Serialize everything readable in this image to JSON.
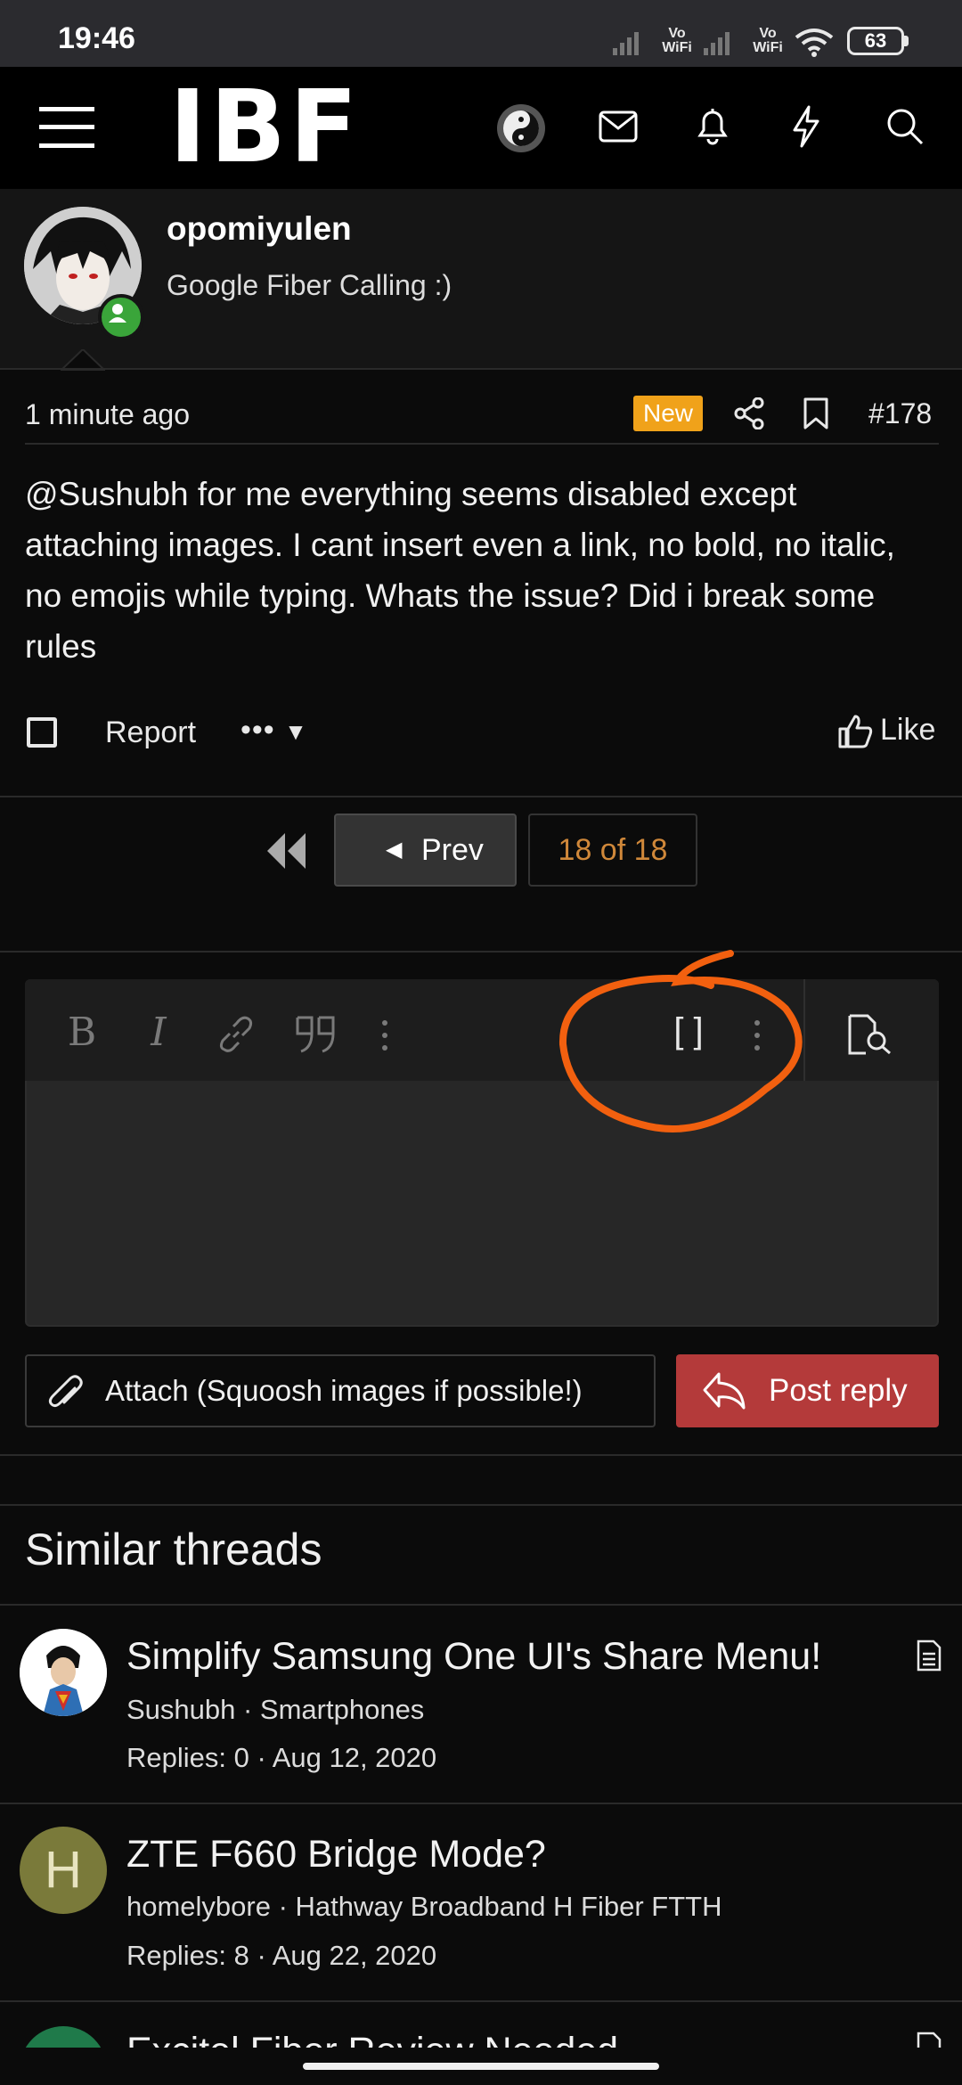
{
  "status_bar": {
    "time": "19:46",
    "vowifi_1": "Vo\nWiFi",
    "vowifi_2": "Vo\nWiFi",
    "battery": "63"
  },
  "header": {
    "logo": "IBF",
    "icons": [
      "menu-icon",
      "yin-yang-icon",
      "mail-icon",
      "bell-icon",
      "bolt-icon",
      "search-icon"
    ]
  },
  "user": {
    "name": "opomiyulen",
    "title": "Google Fiber Calling :)"
  },
  "post": {
    "time": "1 minute ago",
    "badge": "New",
    "number": "#178",
    "text": "@Sushubh for me everything seems disabled except attaching images. I cant insert even a link, no bold, no italic, no emojis while typing. Whats the issue? Did i break some rules",
    "report_label": "Report",
    "more_label": "•••",
    "like_label": "Like"
  },
  "pager": {
    "prev_label": "Prev",
    "current": "18 of 18"
  },
  "editor": {
    "toolbar": [
      "B",
      "I",
      "link",
      "quote",
      "more",
      "[ ]",
      "more",
      "preview"
    ]
  },
  "actions": {
    "attach_label": "Attach (Squoosh images if possible!)",
    "reply_label": "Post reply"
  },
  "similar": {
    "heading": "Similar threads",
    "threads": [
      {
        "title": "Simplify Samsung One UI's Share Menu!",
        "meta": "Sushubh · Smartphones",
        "stats": "Replies: 0 · Aug 12, 2020"
      },
      {
        "title": "ZTE F660 Bridge Mode?",
        "meta": "homelybore · Hathway Broadband H Fiber FTTH",
        "stats": "Replies: 8 · Aug 22, 2020",
        "avatar_letter": "H"
      },
      {
        "title": "Excitel Fiber Review Needed"
      }
    ]
  },
  "colors": {
    "accent_orange": "#f0a21a",
    "reply_red": "#b43a3a",
    "annotation_orange": "#f2600f",
    "online_green": "#3aa53a"
  }
}
